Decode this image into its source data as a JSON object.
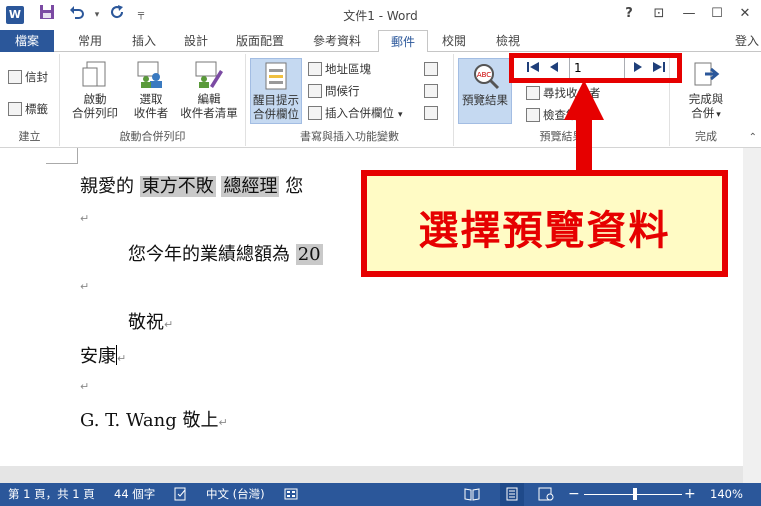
{
  "window": {
    "title": "文件1 - Word",
    "app_icon": "W",
    "help": "?",
    "restore_icon": "⊡",
    "minimize": "—",
    "maximize": "☐",
    "close": "✕"
  },
  "tabs": {
    "file": "檔案",
    "items": [
      "常用",
      "插入",
      "設計",
      "版面配置",
      "參考資料",
      "郵件",
      "校閱",
      "檢視"
    ],
    "active": "郵件",
    "signin": "登入"
  },
  "ribbon": {
    "create": {
      "label": "建立",
      "envelopes": "信封",
      "labels": "標籤"
    },
    "start_merge": {
      "label": "啟動合併列印",
      "start_line1": "啟動",
      "start_line2": "合併列印",
      "select_line1": "選取",
      "select_line2": "收件者",
      "edit_line1": "編輯",
      "edit_line2": "收件者清單"
    },
    "write_insert": {
      "label": "書寫與插入功能變數",
      "highlight_line1": "醒目提示",
      "highlight_line2": "合併欄位",
      "address_block": "地址區塊",
      "greeting_line": "問候行",
      "insert_merge_field": "插入合併欄位"
    },
    "preview": {
      "label": "預覽結果",
      "preview_results": "預覽結果",
      "find_recipient": "尋找收件者",
      "check_errors": "檢查錯誤",
      "record": "1"
    },
    "finish": {
      "label": "完成",
      "finish_line1": "完成與",
      "finish_line2": "合併"
    }
  },
  "document": {
    "line1_prefix": "親愛的",
    "field_name": "東方不敗",
    "field_title": "總經理",
    "line1_suffix": "您",
    "line2_prefix": "您今年的業績總額為",
    "field_amount": "20",
    "closing": "敬祝",
    "wish": "安康",
    "signature": "G. T. Wang 敬上",
    "para_mark": "↵"
  },
  "callout": {
    "text": "選擇預覽資料"
  },
  "status": {
    "page": "第 1 頁，共 1 頁",
    "words": "44 個字",
    "language": "中文 (台灣)",
    "zoom": "140%"
  }
}
